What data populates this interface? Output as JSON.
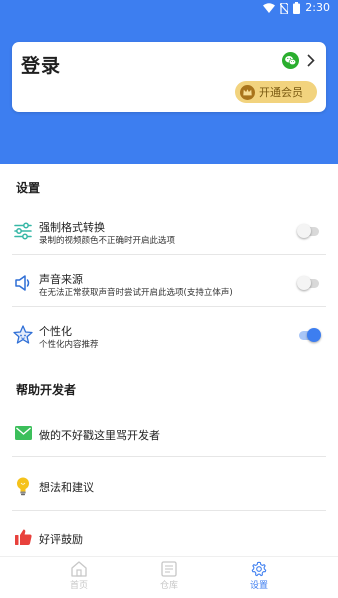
{
  "status_bar": {
    "time": "2:30"
  },
  "login_card": {
    "title": "登录",
    "vip_label": "开通会员"
  },
  "settings": {
    "section_title": "设置",
    "items": [
      {
        "title": "强制格式转换",
        "subtitle": "录制的视频颜色不正确时开启此选项",
        "enabled": false
      },
      {
        "title": "声音来源",
        "subtitle": "在无法正常获取声音时尝试开启此选项(支持立体声)",
        "enabled": false
      },
      {
        "title": "个性化",
        "subtitle": "个性化内容推荐",
        "enabled": true
      }
    ]
  },
  "help": {
    "section_title": "帮助开发者",
    "items": [
      {
        "title": "做的不好戳这里骂开发者"
      },
      {
        "title": "想法和建议"
      },
      {
        "title": "好评鼓励"
      }
    ]
  },
  "bottom_nav": {
    "items": [
      {
        "label": "首页"
      },
      {
        "label": "仓库"
      },
      {
        "label": "设置"
      }
    ],
    "active": "设置"
  },
  "colors": {
    "primary": "#3d7ef0",
    "vip_gold": "#f2d37e",
    "wechat_green": "#2aae2e",
    "mail_green": "#3cbf5b",
    "like_red": "#e8413c",
    "bulb_yellow": "#f5c21b"
  }
}
